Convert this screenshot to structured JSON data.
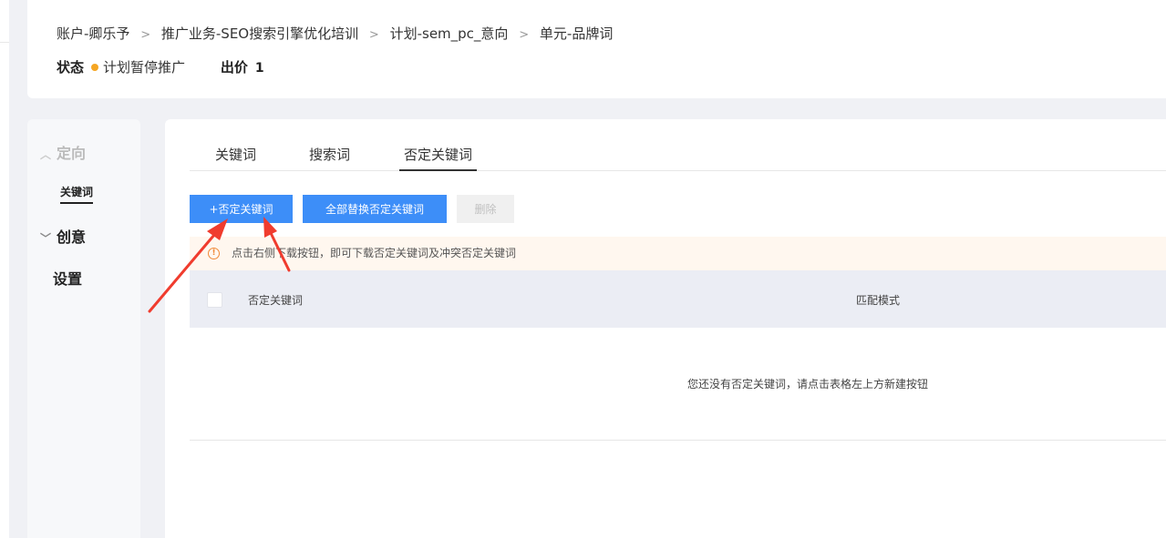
{
  "breadcrumb": {
    "account": "账户-卿乐予",
    "campaign_group": "推广业务-SEO搜索引擎优化培训",
    "plan": "计划-sem_pc_意向",
    "unit": "单元-品牌词",
    "separator": ">"
  },
  "status": {
    "label": "状态",
    "value": "计划暂停推广",
    "dot_color": "#f5a623",
    "bid_label": "出价",
    "bid_value": "1"
  },
  "sidebar": {
    "targeting": "定向",
    "keyword": "关键词",
    "creative": "创意",
    "settings": "设置"
  },
  "tabs": {
    "keyword": "关键词",
    "search_term": "搜索词",
    "negative_keyword": "否定关键词"
  },
  "toolbar": {
    "add_label": "+否定关键词",
    "replace_all_label": "全部替换否定关键词",
    "delete_label": "删除",
    "accent_color": "#3d8ef8"
  },
  "notice": {
    "text": "点击右侧下载按钮，即可下载否定关键词及冲突否定关键词",
    "icon": "warning-circle-icon"
  },
  "table": {
    "columns": [
      "否定关键词",
      "匹配模式"
    ],
    "empty_text": "您还没有否定关键词，请点击表格左上方新建按钮"
  },
  "annotations": {
    "arrow_color": "#f03c2e"
  }
}
